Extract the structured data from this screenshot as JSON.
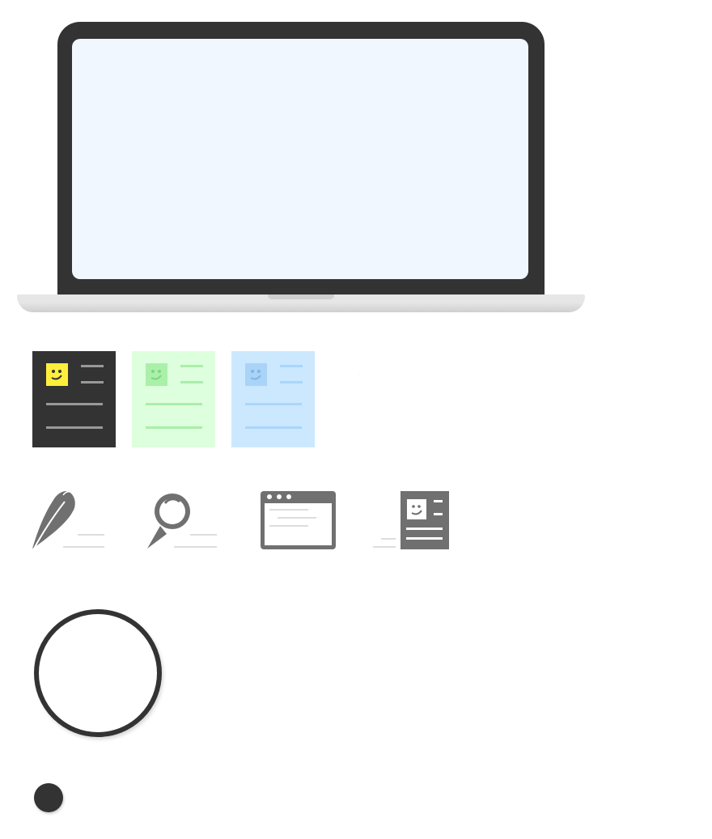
{
  "theme_cards": [
    {
      "name": "dark",
      "background": "#333333",
      "avatar": "#ffef3c",
      "lines": "#999999",
      "face": "#333333"
    },
    {
      "name": "green",
      "background": "#ddffdd",
      "avatar": "#aaf0aa",
      "lines": "#aaeeaa",
      "face": "#7dd87d"
    },
    {
      "name": "blue",
      "background": "#cce8ff",
      "avatar": "#a9d3f7",
      "lines": "#a9d6fb",
      "face": "#7fb7e6"
    },
    {
      "name": "blank",
      "background": "#ffffff",
      "avatar": "#ffffff",
      "lines": "#ffffff",
      "face": "#ffffff"
    }
  ],
  "icons": [
    "feather-icon",
    "magnifier-icon",
    "browser-window-icon",
    "profile-card-icon"
  ],
  "colors": {
    "dark": "#333333",
    "icon_gray": "#707070",
    "line_light": "#dddddd",
    "screen": "#f0f7ff"
  }
}
